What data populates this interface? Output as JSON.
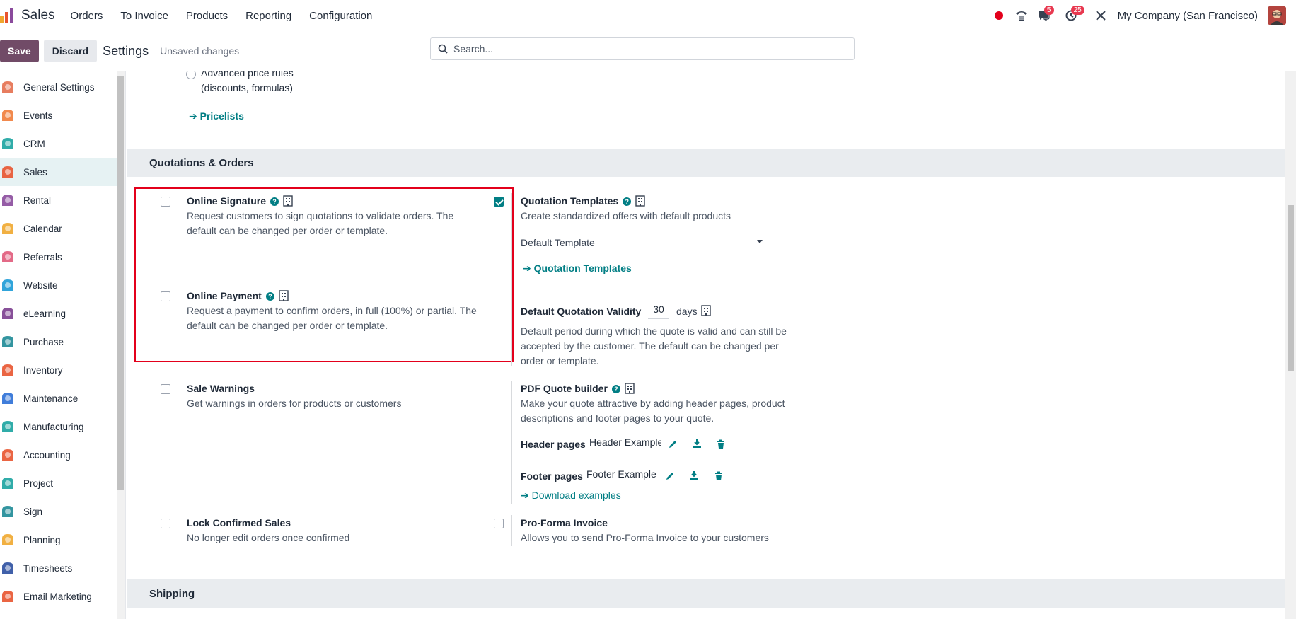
{
  "navbar": {
    "app_name": "Sales",
    "menu": [
      "Orders",
      "To Invoice",
      "Products",
      "Reporting",
      "Configuration"
    ],
    "messages_badge": "5",
    "activities_badge": "25",
    "company": "My Company (San Francisco)"
  },
  "control": {
    "save_label": "Save",
    "discard_label": "Discard",
    "title": "Settings",
    "status": "Unsaved changes",
    "search_placeholder": "Search..."
  },
  "sidebar": {
    "items": [
      {
        "label": "General Settings",
        "icon": "general-settings-icon",
        "color": "#e46f4e"
      },
      {
        "label": "Events",
        "icon": "events-icon",
        "color": "#f07c3a"
      },
      {
        "label": "CRM",
        "icon": "crm-icon",
        "color": "#1aa3a0"
      },
      {
        "label": "Sales",
        "icon": "sales-icon",
        "color": "#e8542f"
      },
      {
        "label": "Rental",
        "icon": "rental-icon",
        "color": "#8a4a9c"
      },
      {
        "label": "Calendar",
        "icon": "calendar-icon",
        "color": "#f0a72e"
      },
      {
        "label": "Referrals",
        "icon": "referrals-icon",
        "color": "#e05a7a"
      },
      {
        "label": "Website",
        "icon": "website-icon",
        "color": "#1a9ad6"
      },
      {
        "label": "eLearning",
        "icon": "elearning-icon",
        "color": "#7b3d8e"
      },
      {
        "label": "Purchase",
        "icon": "purchase-icon",
        "color": "#1d8a96"
      },
      {
        "label": "Inventory",
        "icon": "inventory-icon",
        "color": "#e8542f"
      },
      {
        "label": "Maintenance",
        "icon": "maintenance-icon",
        "color": "#2b6fd6"
      },
      {
        "label": "Manufacturing",
        "icon": "manufacturing-icon",
        "color": "#1aa3a0"
      },
      {
        "label": "Accounting",
        "icon": "accounting-icon",
        "color": "#e8542f"
      },
      {
        "label": "Project",
        "icon": "project-icon",
        "color": "#1aa3a0"
      },
      {
        "label": "Sign",
        "icon": "sign-icon",
        "color": "#1d8a96"
      },
      {
        "label": "Planning",
        "icon": "planning-icon",
        "color": "#f0a72e"
      },
      {
        "label": "Timesheets",
        "icon": "timesheets-icon",
        "color": "#2b4fa0"
      },
      {
        "label": "Email Marketing",
        "icon": "email-marketing-icon",
        "color": "#e8542f"
      }
    ],
    "active_index": 3
  },
  "main": {
    "pricelist_option_line1": "Advanced price rules",
    "pricelist_option_line2": "(discounts, formulas)",
    "pricelists_link": "Pricelists",
    "section_quotations": "Quotations & Orders",
    "online_signature": {
      "title": "Online Signature",
      "desc": "Request customers to sign quotations to validate orders. The default can be changed per order or template.",
      "checked": false
    },
    "online_payment": {
      "title": "Online Payment",
      "desc": "Request a payment to confirm orders, in full (100%) or partial. The default can be changed per order or template.",
      "checked": false
    },
    "quotation_templates": {
      "title": "Quotation Templates",
      "desc": "Create standardized offers with default products",
      "checked": true,
      "default_label": "Default Template",
      "link": "Quotation Templates"
    },
    "validity": {
      "title": "Default Quotation Validity",
      "value": "30",
      "unit": "days",
      "desc": "Default period during which the quote is valid and can still be accepted by the customer. The default can be changed per order or template."
    },
    "sale_warnings": {
      "title": "Sale Warnings",
      "desc": "Get warnings in orders for products or customers",
      "checked": false
    },
    "pdf_builder": {
      "title": "PDF Quote builder",
      "desc": "Make your quote attractive by adding header pages, product descriptions and footer pages to your quote.",
      "header_label": "Header pages",
      "header_value": "Header Example",
      "footer_label": "Footer pages",
      "footer_value": "Footer Example",
      "download_link": "Download examples"
    },
    "lock_sales": {
      "title": "Lock Confirmed Sales",
      "desc": "No longer edit orders once confirmed",
      "checked": false
    },
    "proforma": {
      "title": "Pro-Forma Invoice",
      "desc": "Allows you to send Pro-Forma Invoice to your customers",
      "checked": false
    },
    "section_shipping": "Shipping"
  },
  "colors": {
    "brand": "#714b67",
    "accent": "#017e84",
    "highlight": "#e3001b"
  }
}
